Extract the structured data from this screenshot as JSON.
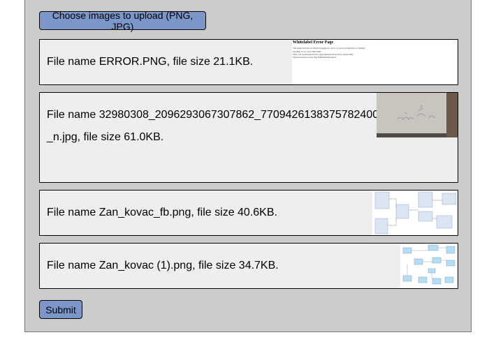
{
  "upload": {
    "choose_label": "Choose images to upload (PNG, JPG)"
  },
  "files": [
    {
      "description": "File name ERROR.PNG, file size 21.1KB.",
      "thumbnail": {
        "title": "Whitelabel Error Page",
        "line1": "This application has no explicit mapping for /error, so you are seeing this as a fallback.",
        "line2": "Sun May 14 17:11:10 CEST 2020",
        "line3": "There was an unexpected error (type=Internal Server Error, status=500).",
        "line4": "Nested exception is java.lang.NullPointerException"
      }
    },
    {
      "description": "File name 32980308_2096293067307862_7709426138375782400_n.jpg, file size 61.0KB."
    },
    {
      "description": "File name Zan_kovac_fb.png, file size 40.6KB."
    },
    {
      "description": "File name Zan_kovac (1).png, file size 34.7KB."
    }
  ],
  "form": {
    "submit_label": "Submit"
  },
  "colors": {
    "button_bg": "#7b96c8",
    "panel_bg": "#cccccc",
    "row_bg": "#eeeeee"
  }
}
